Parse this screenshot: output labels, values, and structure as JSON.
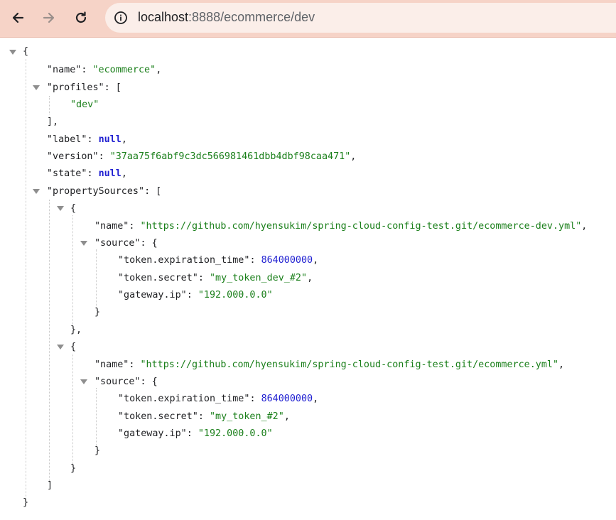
{
  "browser": {
    "back_icon": "arrow-left-icon",
    "forward_icon": "arrow-right-icon",
    "reload_icon": "reload-icon",
    "site_info_icon": "info-circle-icon",
    "url_host": "localhost",
    "url_rest": ":8888/ecommerce/dev",
    "toolbar_color": "#f6d3c7",
    "address_bar_color": "#fbeee9"
  },
  "json": {
    "name_key": "\"name\"",
    "name_val": "\"ecommerce\"",
    "profiles_key": "\"profiles\"",
    "profile_0": "\"dev\"",
    "label_key": "\"label\"",
    "label_val": "null",
    "version_key": "\"version\"",
    "version_val": "\"37aa75f6abf9c3dc566981461dbb4dbf98caa471\"",
    "state_key": "\"state\"",
    "state_val": "null",
    "ps_key": "\"propertySources\"",
    "sources": [
      {
        "name_key": "\"name\"",
        "name_val": "\"https://github.com/hyensukim/spring-cloud-config-test.git/ecommerce-dev.yml\"",
        "source_key": "\"source\"",
        "exp_key": "\"token.expiration_time\"",
        "exp_val": "864000000",
        "secret_key": "\"token.secret\"",
        "secret_val": "\"my_token_dev_#2\"",
        "ip_key": "\"gateway.ip\"",
        "ip_val": "\"192.000.0.0\""
      },
      {
        "name_key": "\"name\"",
        "name_val": "\"https://github.com/hyensukim/spring-cloud-config-test.git/ecommerce.yml\"",
        "source_key": "\"source\"",
        "exp_key": "\"token.expiration_time\"",
        "exp_val": "864000000",
        "secret_key": "\"token.secret\"",
        "secret_val": "\"my_token_#2\"",
        "ip_key": "\"gateway.ip\"",
        "ip_val": "\"192.000.0.0\""
      }
    ],
    "colors": {
      "string": "#1a7f1a",
      "number": "#1f1fd1",
      "keyword": "#1f1fd1",
      "key": "#202124"
    }
  }
}
